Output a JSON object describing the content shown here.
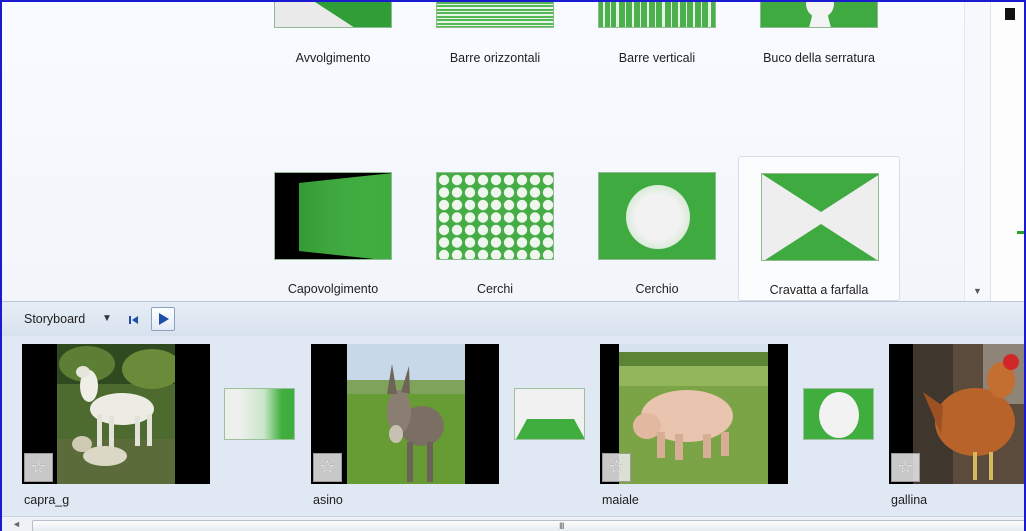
{
  "transitions": {
    "row1": [
      {
        "label": "Avvolgimento"
      },
      {
        "label": "Barre orizzontali"
      },
      {
        "label": "Barre verticali"
      },
      {
        "label": "Buco della serratura"
      }
    ],
    "row2": [
      {
        "label": "Capovolgimento"
      },
      {
        "label": "Cerchi"
      },
      {
        "label": "Cerchio"
      },
      {
        "label": "Cravatta a farfalla",
        "selected": true
      }
    ]
  },
  "storyboard": {
    "label": "Storyboard",
    "clips": [
      {
        "name": "capra_g",
        "icon": "star-icon"
      },
      {
        "name": "asino",
        "icon": "star-icon"
      },
      {
        "name": "maiale",
        "icon": "star-icon"
      },
      {
        "name": "gallina",
        "icon": "star-icon"
      }
    ]
  },
  "colors": {
    "accent_green": "#3fae3f",
    "frame_border": "#1a1ad0",
    "storyboard_bg": "#dfe8f3"
  }
}
